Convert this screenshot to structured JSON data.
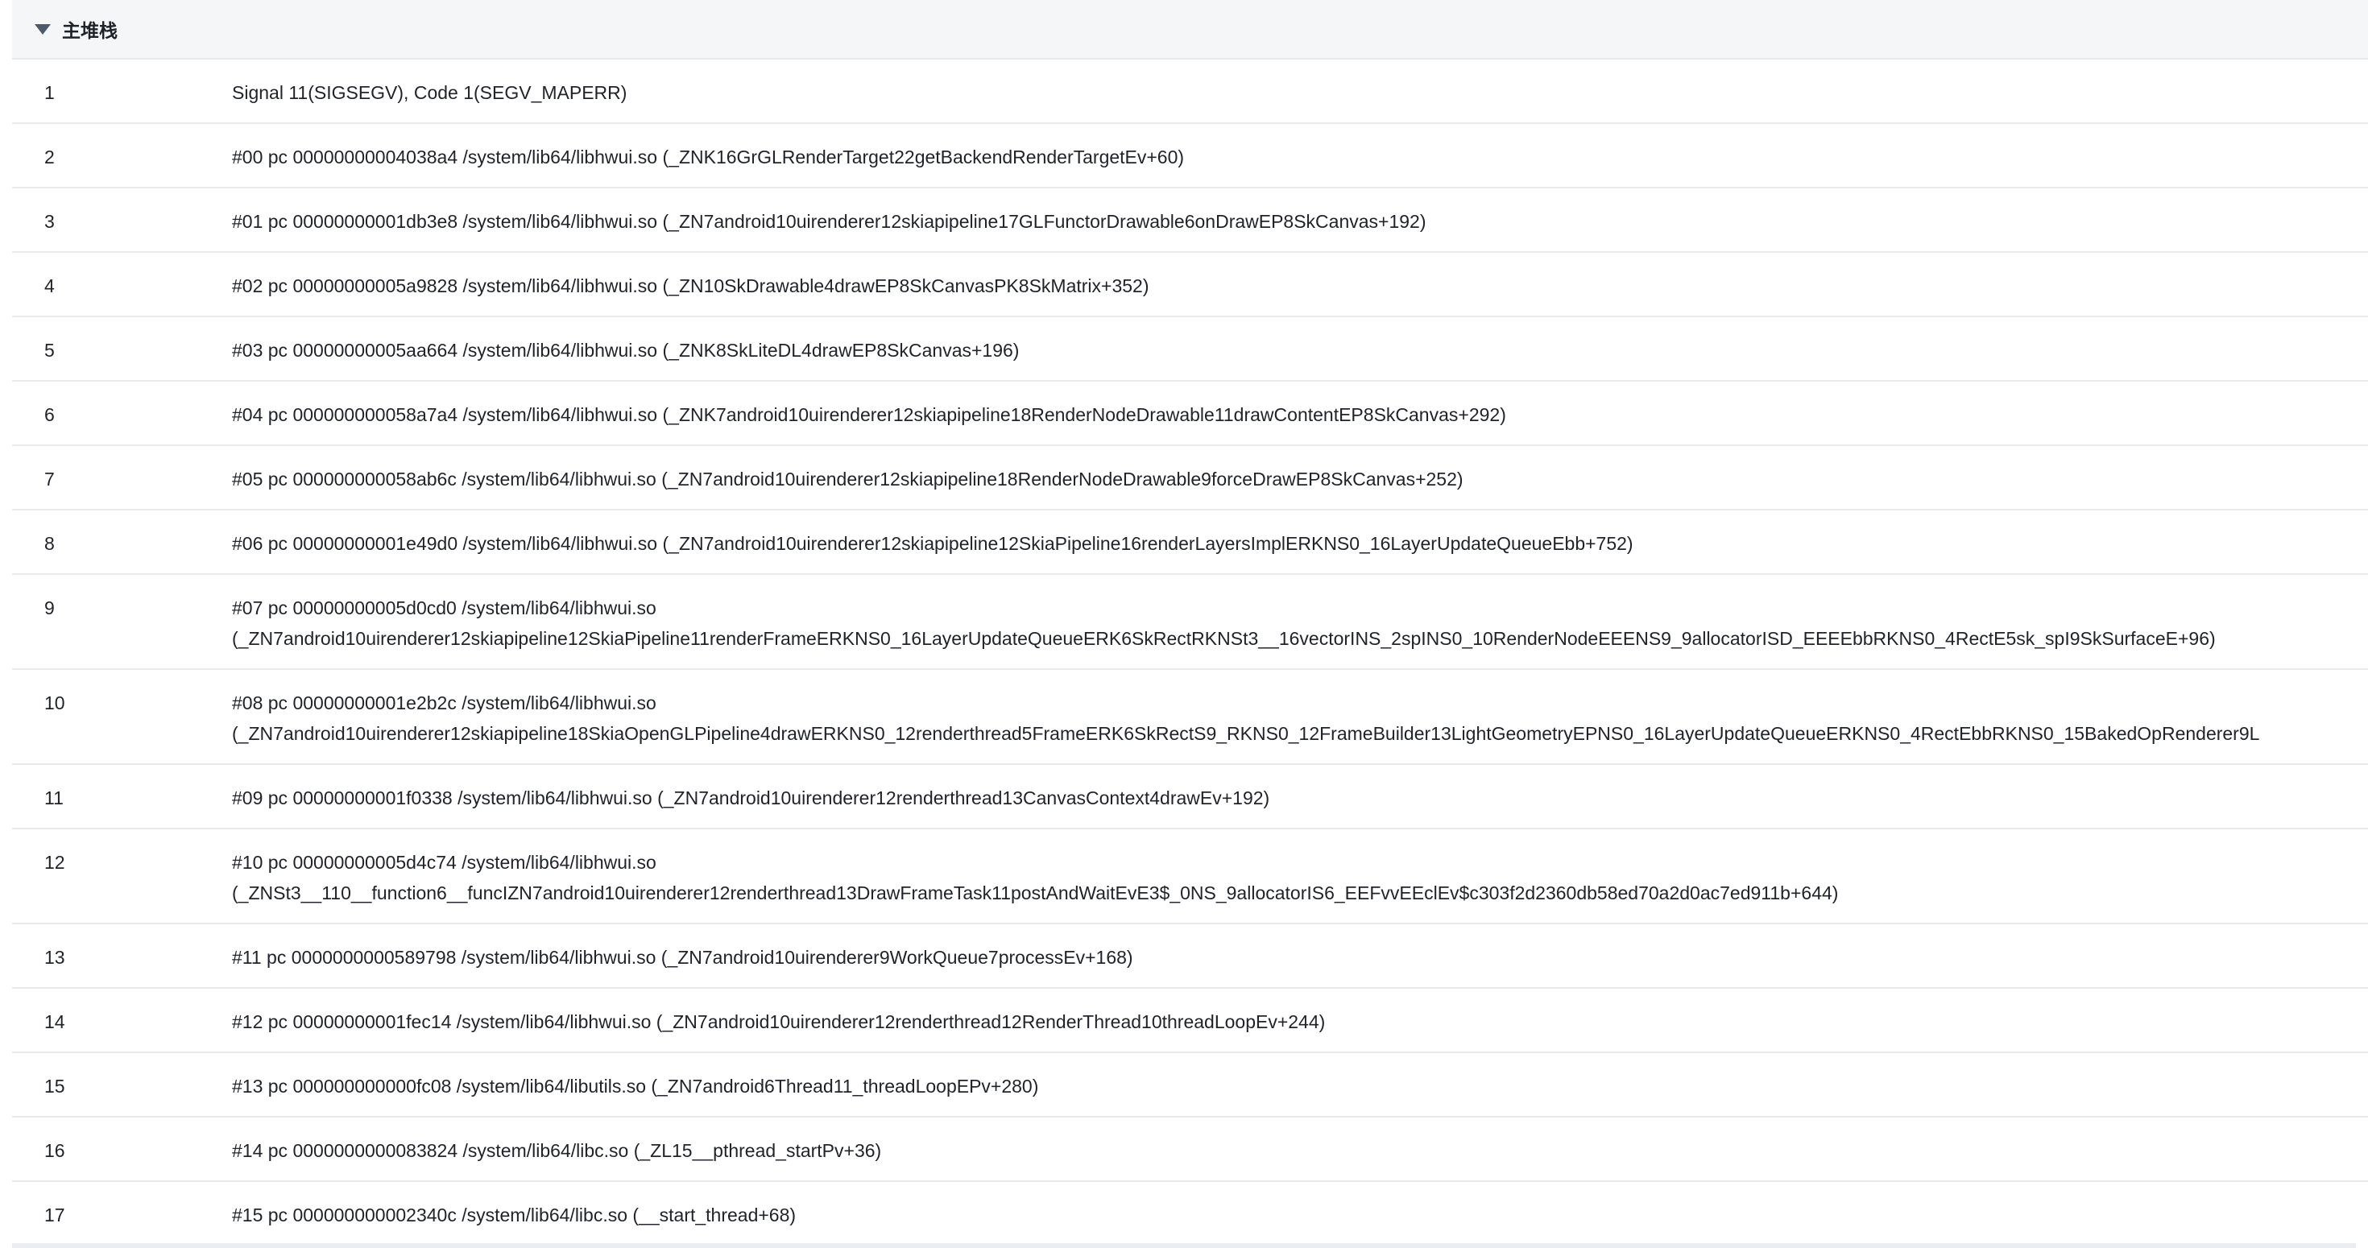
{
  "section": {
    "title": "主堆栈"
  },
  "frames": [
    {
      "index": "1",
      "lines": [
        "Signal 11(SIGSEGV), Code 1(SEGV_MAPERR)"
      ]
    },
    {
      "index": "2",
      "lines": [
        "#00 pc 00000000004038a4 /system/lib64/libhwui.so (_ZNK16GrGLRenderTarget22getBackendRenderTargetEv+60)"
      ]
    },
    {
      "index": "3",
      "lines": [
        "#01 pc 00000000001db3e8 /system/lib64/libhwui.so (_ZN7android10uirenderer12skiapipeline17GLFunctorDrawable6onDrawEP8SkCanvas+192)"
      ]
    },
    {
      "index": "4",
      "lines": [
        "#02 pc 00000000005a9828 /system/lib64/libhwui.so (_ZN10SkDrawable4drawEP8SkCanvasPK8SkMatrix+352)"
      ]
    },
    {
      "index": "5",
      "lines": [
        "#03 pc 00000000005aa664 /system/lib64/libhwui.so (_ZNK8SkLiteDL4drawEP8SkCanvas+196)"
      ]
    },
    {
      "index": "6",
      "lines": [
        "#04 pc 000000000058a7a4 /system/lib64/libhwui.so (_ZNK7android10uirenderer12skiapipeline18RenderNodeDrawable11drawContentEP8SkCanvas+292)"
      ]
    },
    {
      "index": "7",
      "lines": [
        "#05 pc 000000000058ab6c /system/lib64/libhwui.so (_ZN7android10uirenderer12skiapipeline18RenderNodeDrawable9forceDrawEP8SkCanvas+252)"
      ]
    },
    {
      "index": "8",
      "lines": [
        "#06 pc 00000000001e49d0 /system/lib64/libhwui.so (_ZN7android10uirenderer12skiapipeline12SkiaPipeline16renderLayersImplERKNS0_16LayerUpdateQueueEbb+752)"
      ]
    },
    {
      "index": "9",
      "lines": [
        "#07 pc 00000000005d0cd0 /system/lib64/libhwui.so",
        "(_ZN7android10uirenderer12skiapipeline12SkiaPipeline11renderFrameERKNS0_16LayerUpdateQueueERK6SkRectRKNSt3__16vectorINS_2spINS0_10RenderNodeEEENS9_9allocatorISD_EEEEbbRKNS0_4RectE5sk_spI9SkSurfaceE+96)"
      ]
    },
    {
      "index": "10",
      "lines": [
        "#08 pc 00000000001e2b2c /system/lib64/libhwui.so",
        "(_ZN7android10uirenderer12skiapipeline18SkiaOpenGLPipeline4drawERKNS0_12renderthread5FrameERK6SkRectS9_RKNS0_12FrameBuilder13LightGeometryEPNS0_16LayerUpdateQueueERKNS0_4RectEbbRKNS0_15BakedOpRenderer9L"
      ]
    },
    {
      "index": "11",
      "lines": [
        "#09 pc 00000000001f0338 /system/lib64/libhwui.so (_ZN7android10uirenderer12renderthread13CanvasContext4drawEv+192)"
      ]
    },
    {
      "index": "12",
      "lines": [
        "#10 pc 00000000005d4c74 /system/lib64/libhwui.so",
        "(_ZNSt3__110__function6__funcIZN7android10uirenderer12renderthread13DrawFrameTask11postAndWaitEvE3$_0NS_9allocatorIS6_EEFvvEEclEv$c303f2d2360db58ed70a2d0ac7ed911b+644)"
      ]
    },
    {
      "index": "13",
      "lines": [
        "#11 pc 0000000000589798 /system/lib64/libhwui.so (_ZN7android10uirenderer9WorkQueue7processEv+168)"
      ]
    },
    {
      "index": "14",
      "lines": [
        "#12 pc 00000000001fec14 /system/lib64/libhwui.so (_ZN7android10uirenderer12renderthread12RenderThread10threadLoopEv+244)"
      ]
    },
    {
      "index": "15",
      "lines": [
        "#13 pc 000000000000fc08 /system/lib64/libutils.so (_ZN7android6Thread11_threadLoopEPv+280)"
      ]
    },
    {
      "index": "16",
      "lines": [
        "#14 pc 0000000000083824 /system/lib64/libc.so (_ZL15__pthread_startPv+36)"
      ]
    },
    {
      "index": "17",
      "lines": [
        "#15 pc 000000000002340c /system/lib64/libc.so (__start_thread+68)"
      ]
    }
  ]
}
